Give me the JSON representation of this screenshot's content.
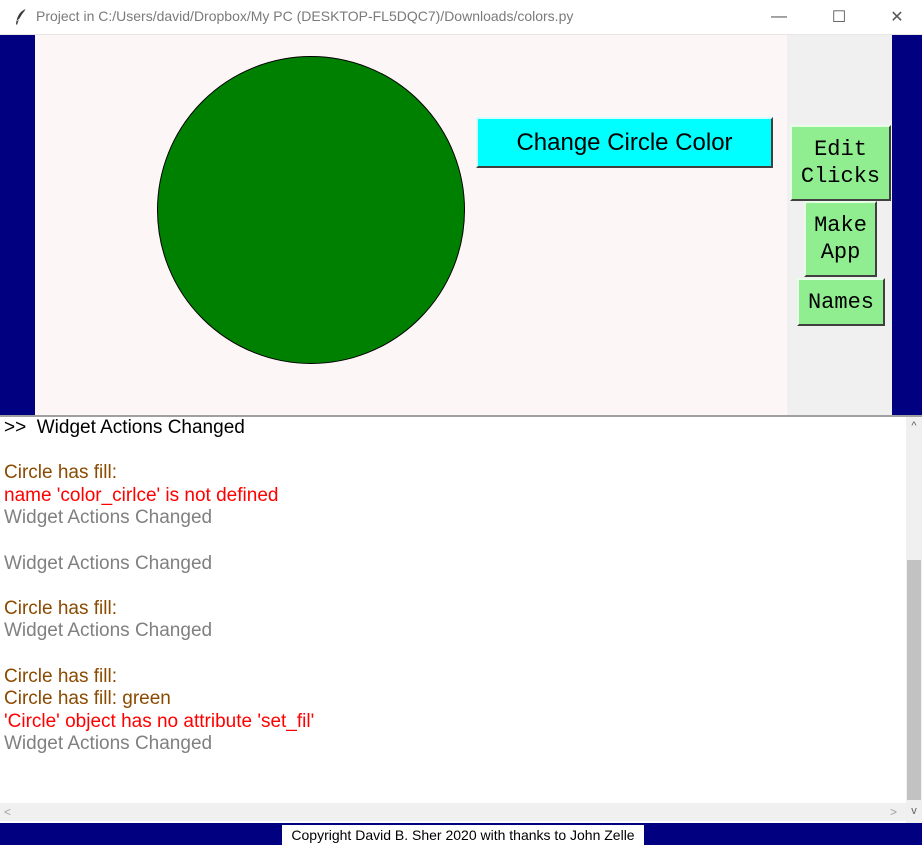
{
  "window": {
    "title": "Project in C:/Users/david/Dropbox/My PC (DESKTOP-FL5DQC7)/Downloads/colors.py",
    "icon": "feather-icon",
    "minimize_glyph": "—",
    "maximize_glyph": "☐",
    "close_glyph": "✕"
  },
  "canvas": {
    "circle_fill": "#008000",
    "button_label": "Change Circle Color",
    "button_color": "#00ffff"
  },
  "side_buttons": {
    "edit_clicks": "Edit\nClicks",
    "make_app": "Make\nApp",
    "names": "Names",
    "color": "#90ee90"
  },
  "console": {
    "lines": [
      {
        "text": ">>  Widget Actions Changed",
        "style": "prompt"
      },
      {
        "text": "",
        "style": "info"
      },
      {
        "text": "Circle has fill:",
        "style": "brown"
      },
      {
        "text": "name 'color_cirlce' is not defined",
        "style": "red"
      },
      {
        "text": "Widget Actions Changed",
        "style": "info"
      },
      {
        "text": "",
        "style": "info"
      },
      {
        "text": "Widget Actions Changed",
        "style": "info"
      },
      {
        "text": "",
        "style": "info"
      },
      {
        "text": "Circle has fill:",
        "style": "brown"
      },
      {
        "text": "Widget Actions Changed",
        "style": "info"
      },
      {
        "text": "",
        "style": "info"
      },
      {
        "text": "Circle has fill:",
        "style": "brown"
      },
      {
        "text": "Circle has fill: green",
        "style": "brown"
      },
      {
        "text": "'Circle' object has no attribute 'set_fil'",
        "style": "red"
      },
      {
        "text": "Widget Actions Changed",
        "style": "info"
      }
    ],
    "scroll_up": "^",
    "scroll_down": "v",
    "scroll_left": "<",
    "scroll_right": ">"
  },
  "footer": {
    "copyright": "Copyright David B. Sher 2020 with thanks to John Zelle"
  },
  "colors": {
    "frame_navy": "#000080",
    "canvas_bg": "#fcf7f6",
    "error_red": "#ff0000",
    "output_brown": "#8b4a00",
    "info_gray": "#808080"
  }
}
